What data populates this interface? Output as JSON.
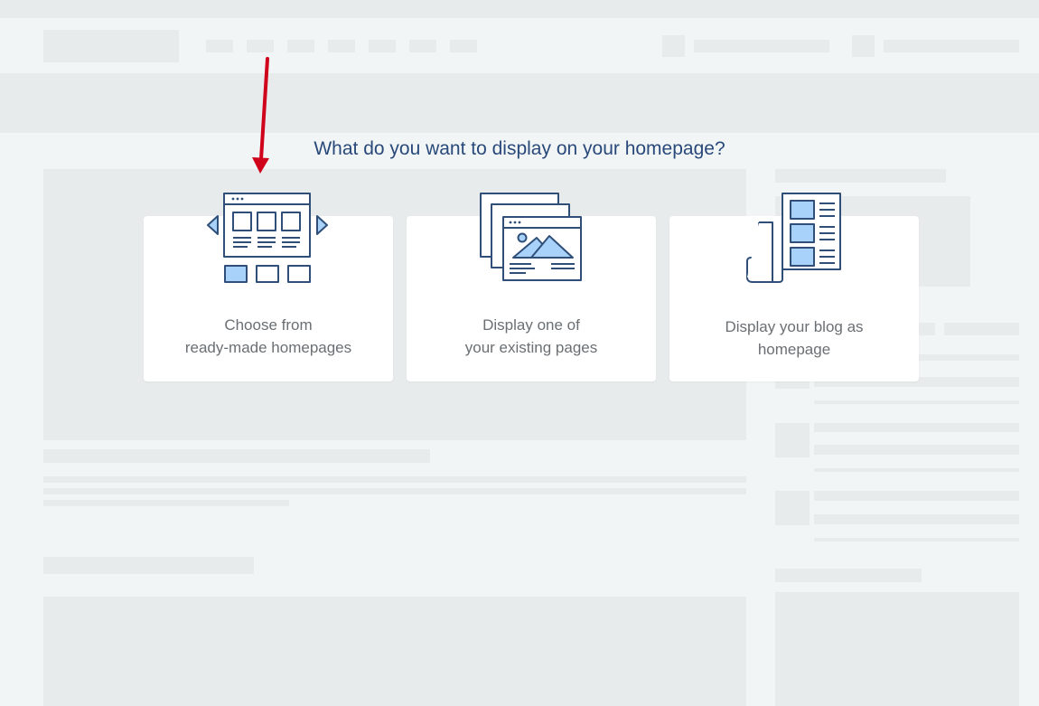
{
  "prompt": {
    "question": "What do you want to display on your homepage?"
  },
  "options": [
    {
      "label": "Choose from\nready-made homepages",
      "icon": "homepage-templates-icon"
    },
    {
      "label": "Display one of\nyour existing pages",
      "icon": "existing-pages-icon"
    },
    {
      "label": "Display your blog as\nhomepage",
      "icon": "blog-newspaper-icon"
    }
  ],
  "colors": {
    "accent": "#28497a",
    "icon_stroke": "#2f4f79",
    "icon_fill": "#a9d2fa",
    "arrow": "#d0021b"
  }
}
